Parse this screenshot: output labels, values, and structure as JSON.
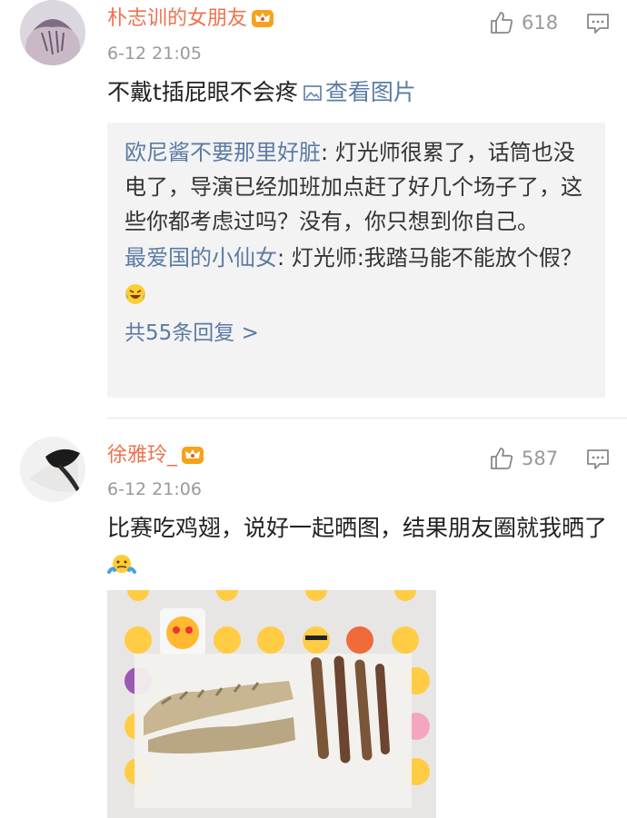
{
  "comments": [
    {
      "username": "朴志训的女朋友",
      "time": "6-12 21:05",
      "likes": "618",
      "text": "不戴t插屁眼不会疼",
      "view_image": "查看图片",
      "replies": [
        {
          "user": "欧尼酱不要那里好脏",
          "text": "灯光师很累了，话筒也没电了，导演已经加班加点赶了好几个场子了，这些你都考虑过吗？没有，你只想到你自己。"
        },
        {
          "user": "最爱国的小仙女",
          "text": "灯光师:我踏马能不能放个假？"
        }
      ],
      "more_replies": "共55条回复 >"
    },
    {
      "username": "徐雅玲_",
      "time": "6-12 21:06",
      "likes": "587",
      "text": "比赛吃鸡翅，说好一起晒图，结果朋友圈就我晒了"
    }
  ],
  "colors": {
    "username": "#eb7350",
    "link": "#5b7ba5",
    "meta": "#999999",
    "reply_bg": "#f3f3f3"
  },
  "icons": [
    "vip-crown-icon",
    "thumbs-up-icon",
    "reply-icon",
    "picture-icon",
    "laugh-cry-emoji",
    "shrug-emoji"
  ]
}
